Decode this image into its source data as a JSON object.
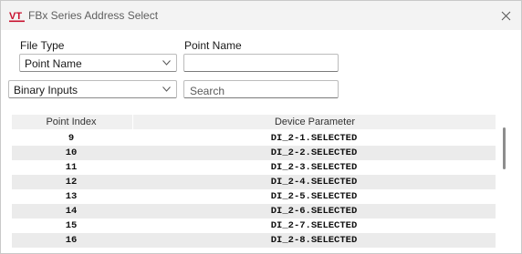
{
  "window": {
    "title": "FBx Series Address Select"
  },
  "file_type": {
    "label": "File Type",
    "selected": "Point Name"
  },
  "point_name": {
    "label": "Point Name",
    "value": ""
  },
  "object_type": {
    "selected": "Binary Inputs"
  },
  "search": {
    "placeholder": "Search",
    "value": ""
  },
  "table": {
    "headers": {
      "index": "Point Index",
      "parameter": "Device Parameter"
    },
    "rows": [
      {
        "index": "9",
        "parameter": "DI_2-1.SELECTED"
      },
      {
        "index": "10",
        "parameter": "DI_2-2.SELECTED"
      },
      {
        "index": "11",
        "parameter": "DI_2-3.SELECTED"
      },
      {
        "index": "12",
        "parameter": "DI_2-4.SELECTED"
      },
      {
        "index": "13",
        "parameter": "DI_2-5.SELECTED"
      },
      {
        "index": "14",
        "parameter": "DI_2-6.SELECTED"
      },
      {
        "index": "15",
        "parameter": "DI_2-7.SELECTED"
      },
      {
        "index": "16",
        "parameter": "DI_2-8.SELECTED"
      }
    ]
  },
  "icons": {
    "logo": "vt-logo-icon",
    "close": "close-icon",
    "dropdown": "chevron-down-icon"
  },
  "colors": {
    "logo_red": "#c8102e",
    "titlebar": "#f3f3f3",
    "header_bg": "#f0f0f0",
    "alt_row": "#ebebeb"
  }
}
